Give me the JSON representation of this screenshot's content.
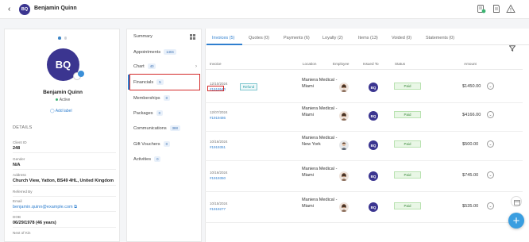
{
  "header": {
    "initials": "BQ",
    "name": "Benjamin Quinn"
  },
  "profile": {
    "initials": "BQ",
    "name": "Benjamin Quinn",
    "status": "Active",
    "add_label": "Add label",
    "details_title": "DETAILS",
    "details": [
      {
        "label": "Client ID",
        "value": "248"
      },
      {
        "label": "Gender",
        "value": "N/A"
      },
      {
        "label": "Address",
        "value": "Church View, Yatton, BS49 4HL, United Kingdom"
      },
      {
        "label": "Referred By",
        "value": ""
      },
      {
        "label": "Email",
        "value": "benjamin.quinn@example.com"
      },
      {
        "label": "DOB",
        "value": "06/29/1978 (46 years)"
      },
      {
        "label": "Next of Kin",
        "value": ""
      }
    ]
  },
  "menu": {
    "summary": "Summary",
    "items": [
      {
        "label": "Appointments",
        "count": "1404"
      },
      {
        "label": "Chart",
        "count": "40"
      },
      {
        "label": "Financials",
        "count": "5"
      },
      {
        "label": "Memberships",
        "count": "0"
      },
      {
        "label": "Packages",
        "count": "0"
      },
      {
        "label": "Communications",
        "count": "388"
      },
      {
        "label": "Gift Vouchers",
        "count": "0"
      },
      {
        "label": "Activities",
        "count": "0"
      }
    ]
  },
  "tabs": [
    "Invoices (5)",
    "Quotes (0)",
    "Payments (6)",
    "Loyalty (2)",
    "Items (13)",
    "Voided (0)",
    "Statements (0)"
  ],
  "columns": [
    "Invoice",
    "Location",
    "Employee",
    "Issued To",
    "Status",
    "Amount"
  ],
  "rows": [
    {
      "date": "12/10/2024",
      "id": "#1919540",
      "refund": "Refund",
      "location": "Maniera Medical - Miami",
      "issued": "BQ",
      "status": "Paid",
      "amount": "$1450.00"
    },
    {
      "date": "12/07/2024",
      "id": "#1919486",
      "refund": "",
      "location": "Maniera Medical - Miami",
      "issued": "BQ",
      "status": "Paid",
      "amount": "$4166.00"
    },
    {
      "date": "10/16/2024",
      "id": "#1919351",
      "refund": "",
      "location": "Maniera Medical - New York",
      "issued": "BQ",
      "status": "Paid",
      "amount": "$500.00"
    },
    {
      "date": "10/16/2024",
      "id": "#1919350",
      "refund": "",
      "location": "Maniera Medical - Miami",
      "issued": "BQ",
      "status": "Paid",
      "amount": "$745.00"
    },
    {
      "date": "10/15/2024",
      "id": "#1919277",
      "refund": "",
      "location": "Maniera Medical - Miami",
      "issued": "BQ",
      "status": "Paid",
      "amount": "$535.00"
    }
  ],
  "colors": {
    "accent": "#2f7fcf",
    "avatar": "#3b3590",
    "highlight": "#d42a2a",
    "fab": "#3a9ee0"
  },
  "icons": {
    "back": "arrow-left-icon",
    "top_right": [
      "client-card-icon",
      "document-icon",
      "warning-icon"
    ],
    "filter": "filter-icon",
    "grid": "grid-icon",
    "fab": "plus-icon"
  }
}
